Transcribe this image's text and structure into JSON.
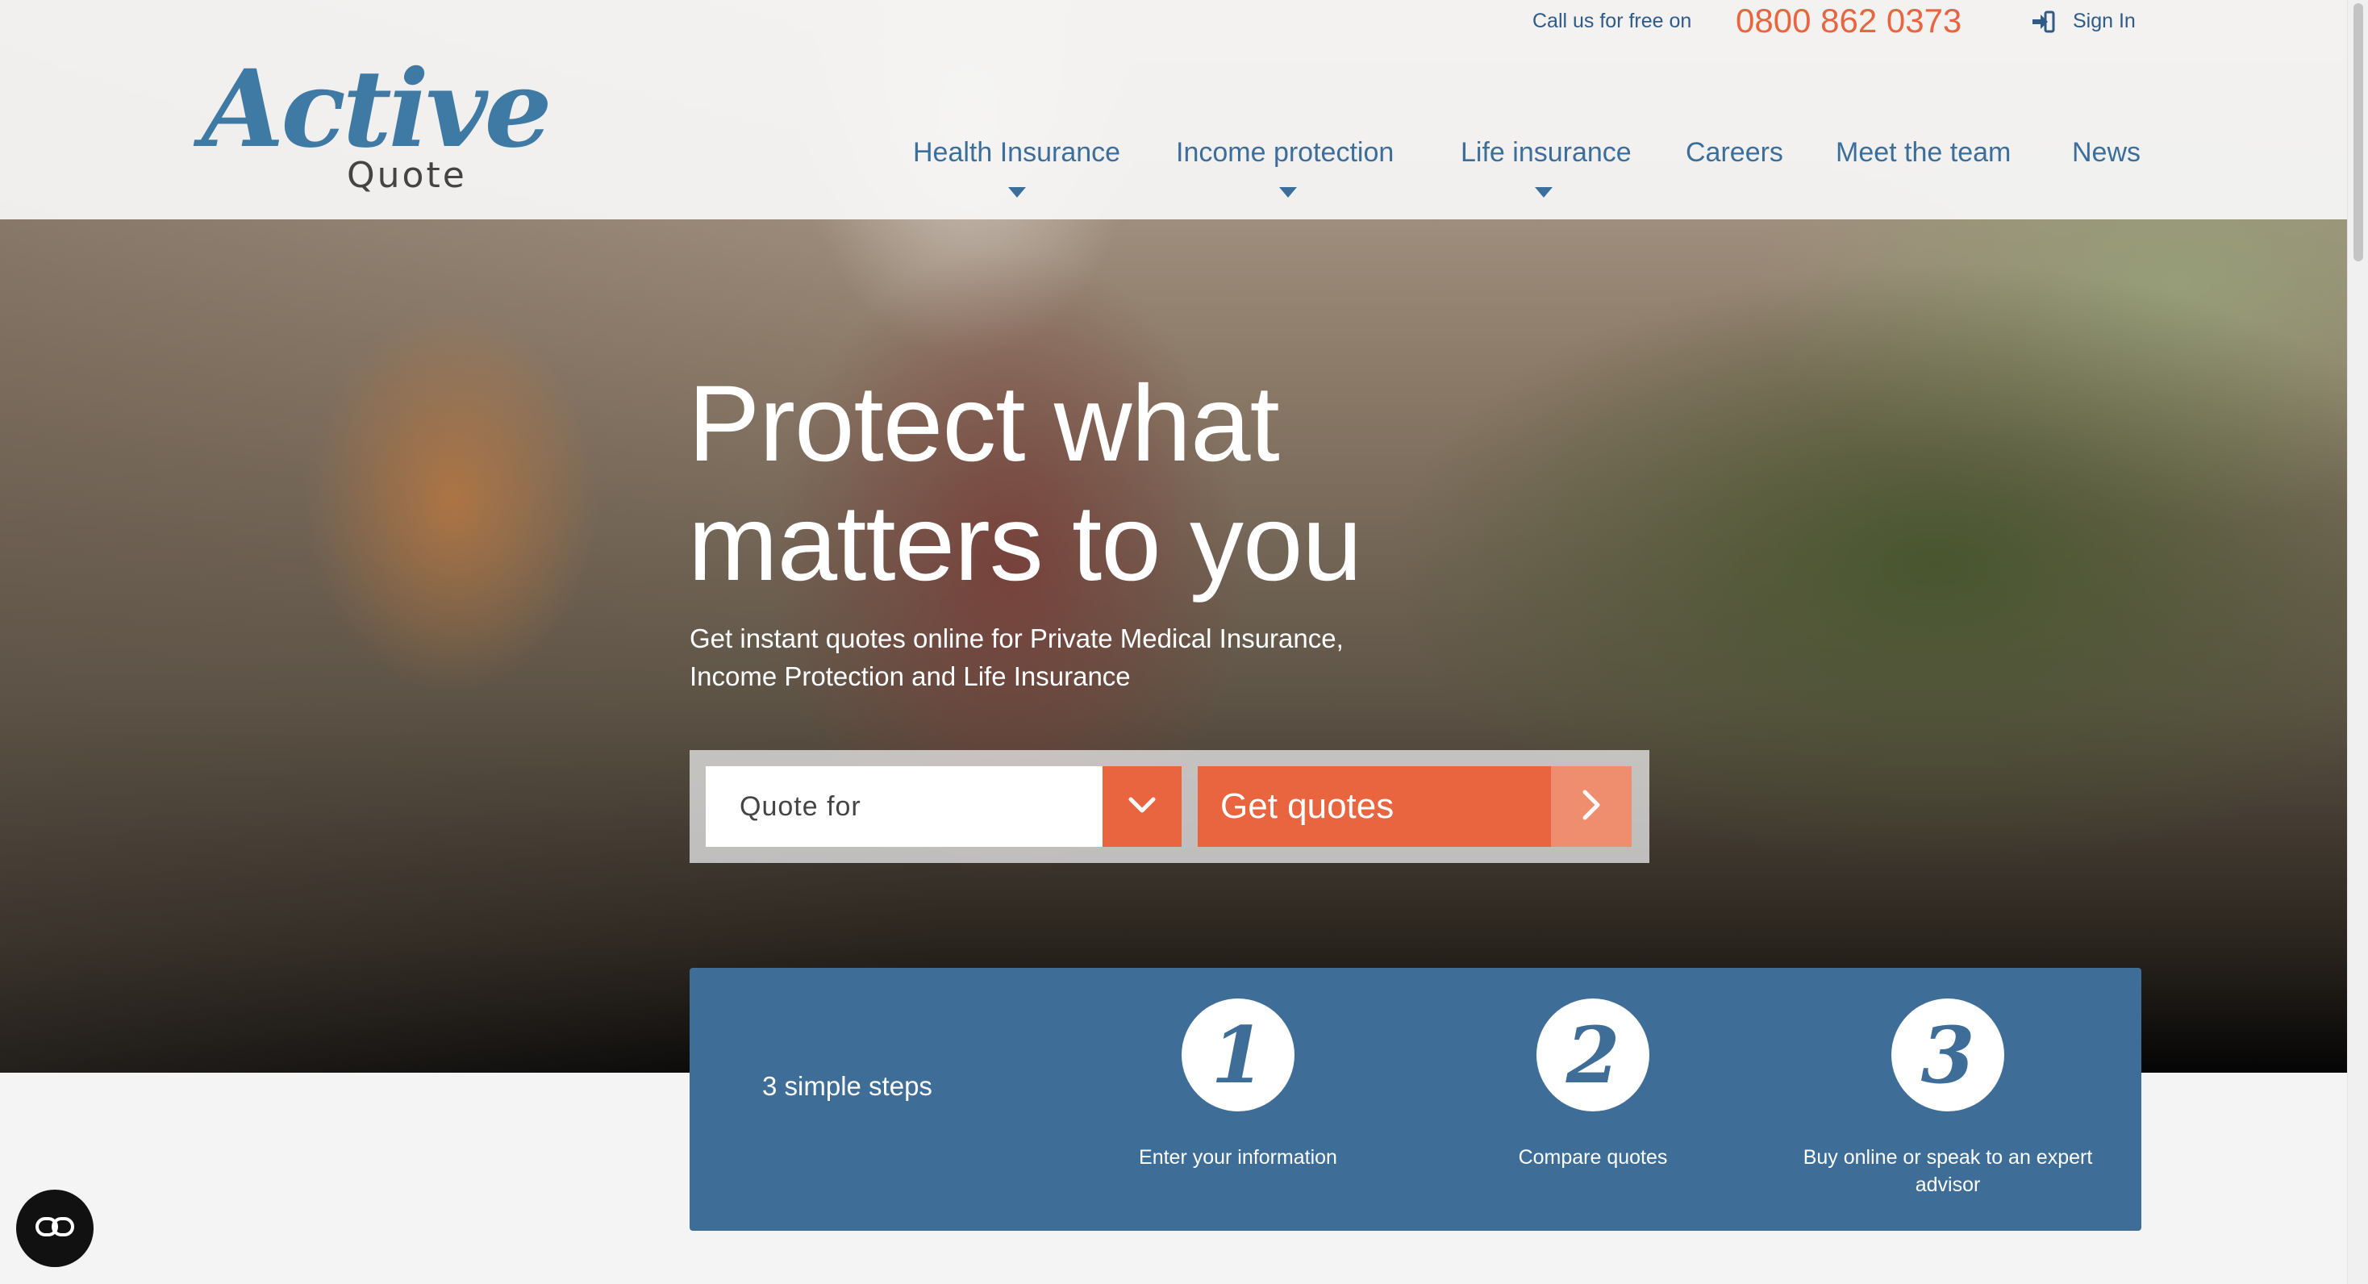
{
  "logo": {
    "word": "Active",
    "sub": "Quote"
  },
  "topbar": {
    "call_label": "Call us for free on",
    "phone": "0800 862 0373",
    "signin": "Sign In"
  },
  "nav": [
    {
      "label": "Health Insurance",
      "has_dropdown": true
    },
    {
      "label": "Income protection",
      "has_dropdown": true
    },
    {
      "label": "Life insurance",
      "has_dropdown": true
    },
    {
      "label": "Careers",
      "has_dropdown": false
    },
    {
      "label": "Meet the team",
      "has_dropdown": false
    },
    {
      "label": "News",
      "has_dropdown": false
    }
  ],
  "hero": {
    "headline_line1": "Protect what",
    "headline_line2": "matters to you",
    "sub_line1": "Get instant quotes online for Private Medical Insurance,",
    "sub_line2": "Income Protection and Life Insurance"
  },
  "quote_form": {
    "select_value": "Quote for",
    "button_label": "Get quotes"
  },
  "steps": {
    "title": "3 simple steps",
    "items": [
      {
        "number": "1",
        "label": "Enter your information"
      },
      {
        "number": "2",
        "label": "Compare quotes"
      },
      {
        "number": "3",
        "label": "Buy online or speak to an expert advisor"
      }
    ]
  },
  "colors": {
    "brand_blue": "#3e6e98",
    "accent_orange": "#e8653f",
    "nav_blue": "#3b6e9a"
  }
}
